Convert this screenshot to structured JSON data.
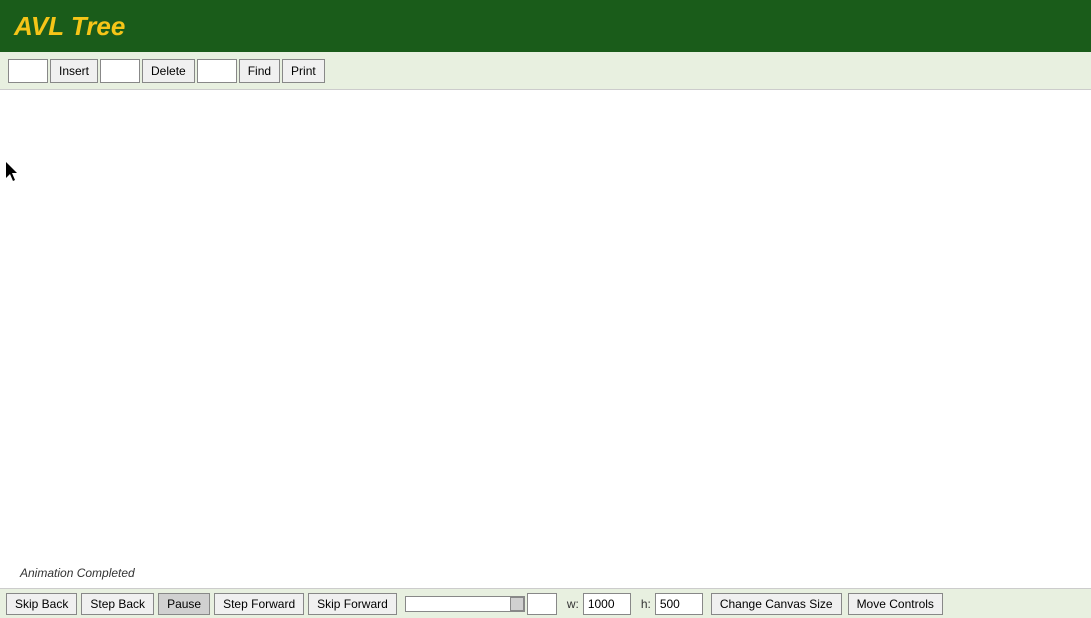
{
  "header": {
    "title": "AVL Tree"
  },
  "toolbar": {
    "insert_label": "Insert",
    "delete_label": "Delete",
    "find_label": "Find",
    "print_label": "Print",
    "insert_input_value": "",
    "delete_input_value": "",
    "find_input_value": ""
  },
  "canvas": {
    "animation_status": "Animation Completed"
  },
  "bottom_bar": {
    "skip_back_label": "Skip Back",
    "step_back_label": "Step Back",
    "pause_label": "Pause",
    "step_forward_label": "Step Forward",
    "skip_forward_label": "Skip Forward",
    "width_label": "w:",
    "width_value": "1000",
    "height_label": "h:",
    "height_value": "500",
    "change_canvas_size_label": "Change Canvas Size",
    "move_controls_label": "Move Controls"
  }
}
